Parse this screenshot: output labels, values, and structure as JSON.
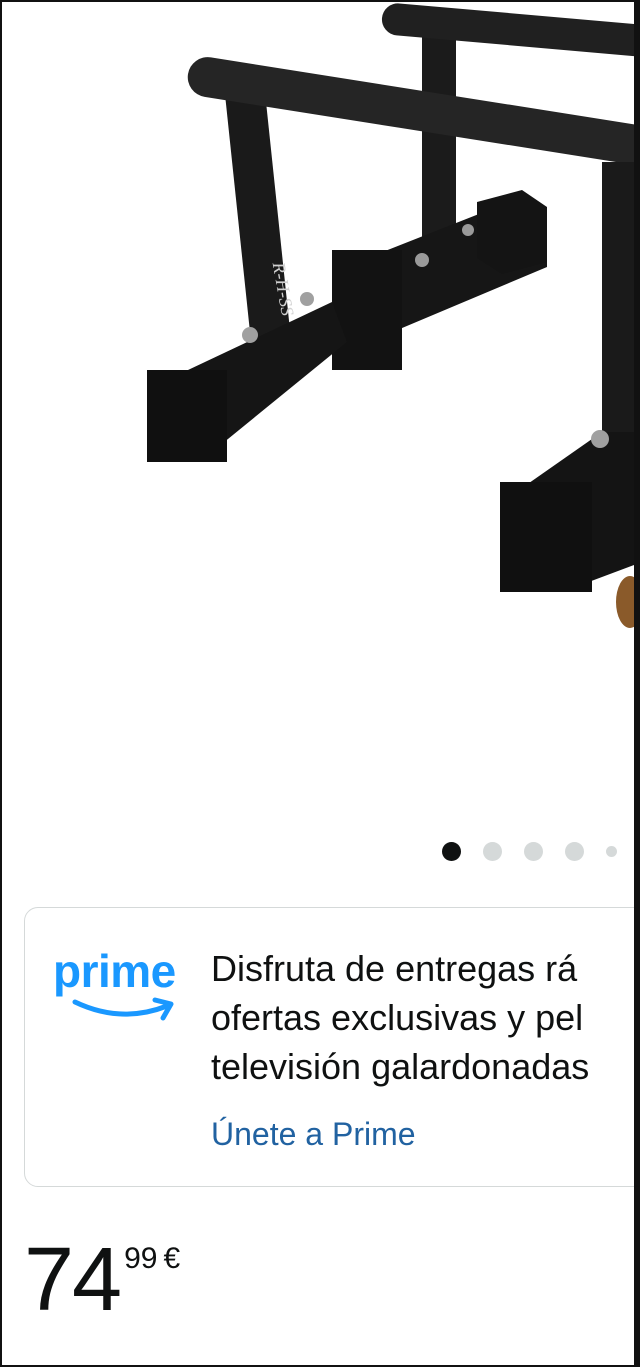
{
  "product": {
    "image_alt": "Paralelas de entrenamiento negras",
    "logo_text": "R-H-SS"
  },
  "carousel": {
    "count": 5,
    "active_index": 0
  },
  "prime_card": {
    "logo": "prime",
    "lines": [
      "Disfruta de entregas rá",
      "ofertas exclusivas y pel",
      "televisión galardonadas"
    ],
    "link_label": "Únete a Prime",
    "accent_color": "#1a98ff",
    "link_color": "#2162a1"
  },
  "price": {
    "whole": "74",
    "fraction": "99",
    "currency": "€"
  }
}
